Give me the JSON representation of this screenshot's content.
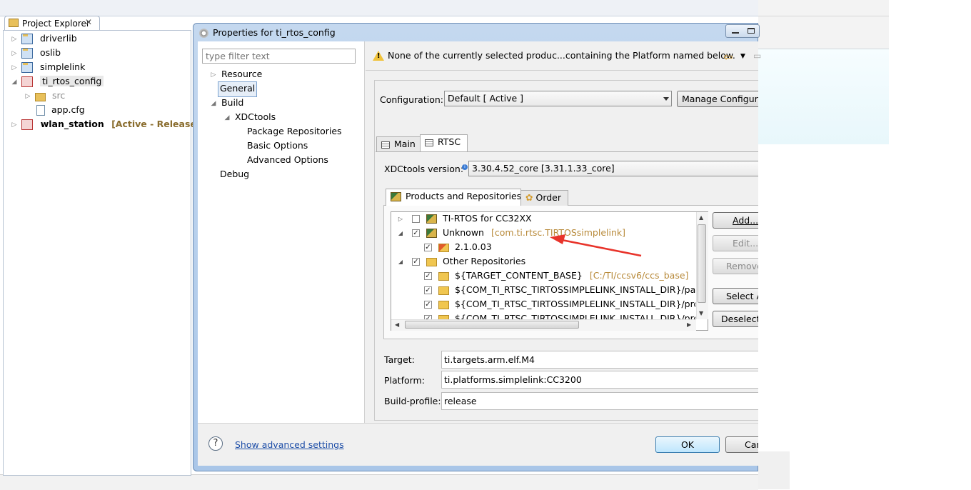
{
  "explorer": {
    "tab_title": "Project Explorer",
    "close_glyph": "✕",
    "items": [
      {
        "label": "driverlib",
        "icon": "ccs-project-icon",
        "expanded": false
      },
      {
        "label": "oslib",
        "icon": "ccs-project-icon",
        "expanded": false
      },
      {
        "label": "simplelink",
        "icon": "ccs-project-icon",
        "expanded": false
      },
      {
        "label": "ti_rtos_config",
        "icon": "rtsc-project-icon",
        "expanded": true
      },
      {
        "label": "src",
        "icon": "source-folder-icon",
        "expanded": false
      },
      {
        "label": "app.cfg",
        "icon": "cfg-file-icon"
      },
      {
        "label": "wlan_station",
        "icon": "rtsc-project-icon",
        "expanded": false,
        "status": "[Active - Release]"
      }
    ]
  },
  "dialog": {
    "title": "Properties for ti_rtos_config",
    "filter_placeholder": "type filter text",
    "nav": [
      {
        "label": "Resource"
      },
      {
        "label": "General",
        "selected": true
      },
      {
        "label": "Build"
      },
      {
        "label": "XDCtools"
      },
      {
        "label": "Package Repositories"
      },
      {
        "label": "Basic Options"
      },
      {
        "label": "Advanced Options"
      },
      {
        "label": "Debug"
      }
    ],
    "message": "None of the currently selected produc...containing the Platform named below.",
    "configuration": {
      "label": "Configuration:",
      "value": "Default  [ Active ]",
      "manage_button": "Manage Configurations..."
    },
    "tabs": [
      {
        "label": "Main",
        "active": false
      },
      {
        "label": "RTSC",
        "active": true
      }
    ],
    "xdctools": {
      "label": "XDCtools version:",
      "value": "3.30.4.52_core  [3.31.1.33_core]"
    },
    "subtabs": [
      {
        "label": "Products and Repositories",
        "active": true
      },
      {
        "label": "Order",
        "active": false
      }
    ],
    "products": [
      {
        "label": "TI-RTOS for CC32XX",
        "checked": false,
        "expander": "▷"
      },
      {
        "label": "Unknown",
        "note": "[com.ti.rtsc.TIRTOSsimplelink]",
        "checked": true,
        "expander": "◢"
      },
      {
        "label": "2.1.0.03",
        "checked": true
      },
      {
        "label": "Other Repositories",
        "checked": true,
        "expander": "◢"
      },
      {
        "label": "${TARGET_CONTENT_BASE}",
        "note": "[C:/TI/ccsv6/ccs_base]",
        "checked": true
      },
      {
        "label": "${COM_TI_RTSC_TIRTOSSIMPLELINK_INSTALL_DIR}/packages",
        "checked": true
      },
      {
        "label": "${COM_TI_RTSC_TIRTOSSIMPLELINK_INSTALL_DIR}/products",
        "checked": true
      },
      {
        "label": "${COM_TI_RTSC_TIRTOSSIMPLELINK_INSTALL_DIR}/products",
        "checked": true
      }
    ],
    "side_buttons": {
      "add": "Add...",
      "edit": "Edit...",
      "remove": "Remove",
      "select_all": "Select All",
      "deselect_all": "Deselect All"
    },
    "target": {
      "label": "Target:",
      "value": "ti.targets.arm.elf.M4"
    },
    "platform": {
      "label": "Platform:",
      "value": "ti.platforms.simplelink:CC3200"
    },
    "build_profile": {
      "label": "Build-profile:",
      "value": "release"
    },
    "help_glyph": "?",
    "advanced_link": "Show advanced settings",
    "ok_button": "OK",
    "cancel_button": "Cancel"
  },
  "colors": {
    "annotation_arrow": "#e8332a",
    "link": "#1f4fa8",
    "status_text": "#8a6d2e"
  }
}
